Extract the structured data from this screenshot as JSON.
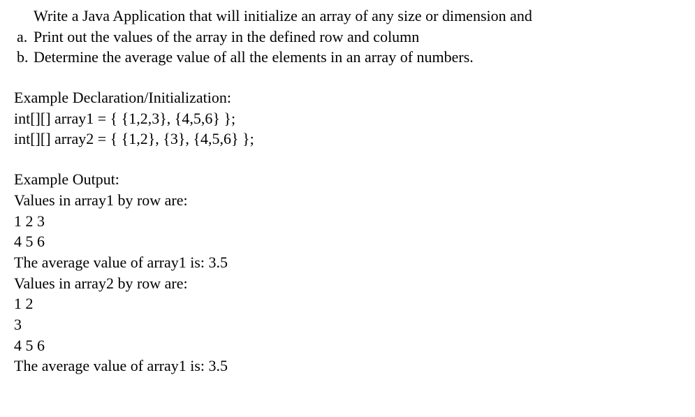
{
  "intro": "Write a Java Application that will initialize an array of any size or dimension and",
  "list": {
    "a": {
      "marker": "a.",
      "text": "Print out the values of the array in the defined row and column"
    },
    "b": {
      "marker": "b.",
      "text": "Determine the average value of all the elements in an array of numbers."
    }
  },
  "declaration": {
    "heading": "Example Declaration/Initialization:",
    "line1": "int[][] array1 = { {1,2,3}, {4,5,6} };",
    "line2": "int[][] array2 = { {1,2}, {3}, {4,5,6} };"
  },
  "output": {
    "heading": "Example Output:",
    "lines": [
      "Values in array1 by row are:",
      "1 2 3",
      "4 5 6",
      "The average value of array1 is:  3.5",
      "Values in array2 by row are:",
      "1 2",
      "3",
      "4 5 6",
      "The average value of array1 is:  3.5"
    ]
  }
}
